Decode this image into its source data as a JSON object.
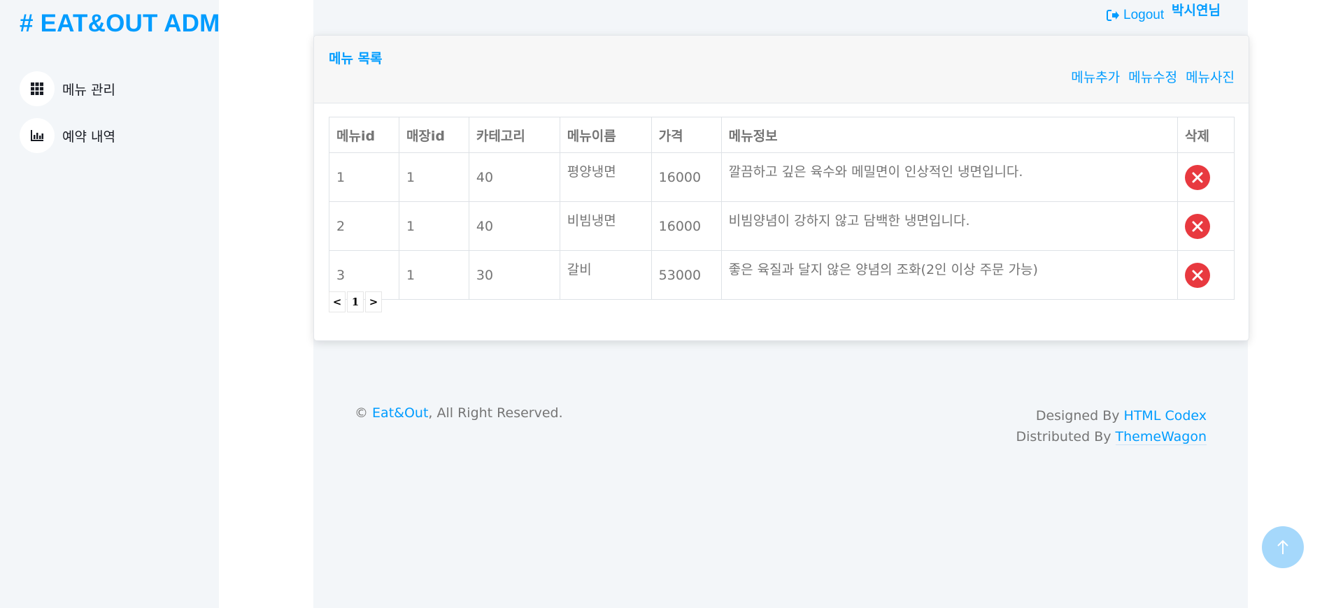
{
  "app": {
    "brand": "# EAT&OUT ADM"
  },
  "sidebar": {
    "items": [
      {
        "label": "메뉴 관리",
        "icon": "grid-icon"
      },
      {
        "label": "예약 내역",
        "icon": "bar-chart-icon"
      }
    ]
  },
  "topbar": {
    "logout_label": "Logout",
    "user_name": "박시연님"
  },
  "menu_card": {
    "title": "메뉴 목록",
    "actions": [
      "메뉴추가",
      "메뉴수정",
      "메뉴사진"
    ],
    "columns": [
      "메뉴id",
      "매장id",
      "카테고리",
      "메뉴이름",
      "가격",
      "메뉴정보",
      "삭제"
    ],
    "rows": [
      [
        "1",
        "1",
        "40",
        "평양냉면",
        "16000",
        "깔끔하고 깊은 육수와 메밀면이 인상적인 냉면입니다."
      ],
      [
        "2",
        "1",
        "40",
        "비빔냉면",
        "16000",
        "비빔양념이 강하지 않고 담백한 냉면입니다."
      ],
      [
        "3",
        "1",
        "30",
        "갈비",
        "53000",
        "좋은 육질과 달지 않은 양념의 조화(2인 이상 주문 가능)"
      ]
    ],
    "pagination": {
      "prev": "<",
      "current": "1",
      "next": ">"
    }
  },
  "footer": {
    "copyright_prefix": "©",
    "site_link": "Eat&Out",
    "rights": ", All Right Reserved.",
    "designed_by": "Designed By",
    "designer_link": "HTML Codex",
    "distributed_by": "Distributed By",
    "distributor_link": "ThemeWagon"
  },
  "colors": {
    "accent": "#009cff",
    "danger": "#e8393f",
    "light_bg": "#f3f6f9"
  }
}
